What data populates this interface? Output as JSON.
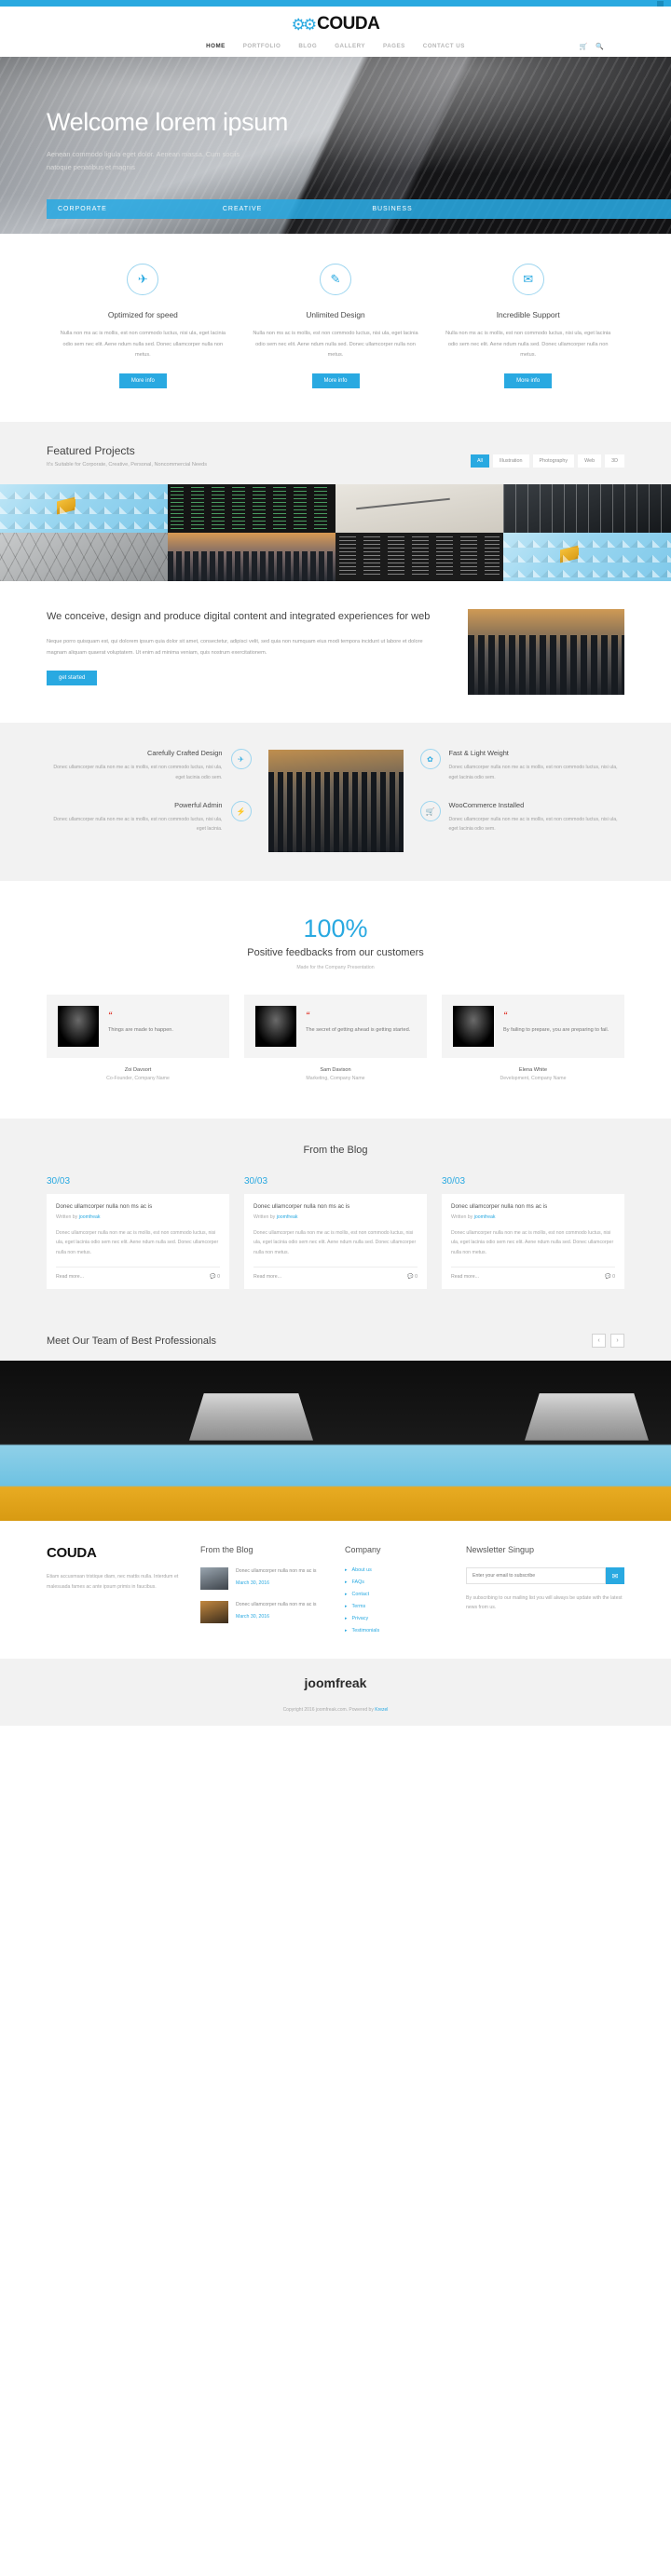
{
  "brand": {
    "name": "COUDA",
    "gears_icon": "gears-icon",
    "accent": "#29a9e1"
  },
  "nav": {
    "items": [
      {
        "label": "HOME",
        "active": true
      },
      {
        "label": "PORTFOLIO",
        "active": false
      },
      {
        "label": "BLOG",
        "active": false
      },
      {
        "label": "GALLERY",
        "active": false
      },
      {
        "label": "PAGES",
        "active": false
      },
      {
        "label": "CONTACT US",
        "active": false
      }
    ],
    "cart_icon": "cart-icon",
    "search_icon": "search-icon"
  },
  "hero": {
    "title": "Welcome lorem ipsum",
    "subtitle": "Aenean commodo ligula eget dolor. Aenean massa. Cum sociis natoque penatibus et magnis",
    "strip": [
      "CORPORATE",
      "CREATIVE",
      "BUSINESS"
    ]
  },
  "services": {
    "items": [
      {
        "icon": "rocket-icon",
        "title": "Optimized for speed",
        "text": "Nulla non ms ac is mollis, est non commodo luctus, nisi ula, eget lacinia odio sem nec elit. Aene ndum nulla sed. Donec ullamcorper nulla non metus.",
        "button": "More info"
      },
      {
        "icon": "pencil-icon",
        "title": "Unlimited Design",
        "text": "Nulla non ms ac is mollis, est non commodo luctus, nisi ula, eget lacinia odio sem nec elit. Aene ndum nulla sed. Donec ullamcorper nulla non metus.",
        "button": "More info"
      },
      {
        "icon": "chat-icon",
        "title": "Incredible Support",
        "text": "Nulla non ms ac is mollis, est non commodo luctus, nisi ula, eget lacinia odio sem nec elit. Aene ndum nulla sed. Donec ullamcorper nulla non metus.",
        "button": "More info"
      }
    ]
  },
  "featured": {
    "title": "Featured Projects",
    "subtitle": "It's Suitable for Corporate, Creative, Personal, Noncommercial Needs",
    "filters": [
      {
        "label": "All",
        "active": true
      },
      {
        "label": "Illustration",
        "active": false
      },
      {
        "label": "Photography",
        "active": false
      },
      {
        "label": "Web",
        "active": false
      },
      {
        "label": "3D",
        "active": false
      }
    ]
  },
  "conceive": {
    "title": "We conceive, design and produce digital content and integrated experiences for web",
    "text": "Neque porro quisquam est, qui dolorem ipsum quia dolor sit amet, consectetur, adipisci velit, sed quia non numquam eius modi tempora incidunt ut labore et dolore magnam aliquam quaerat voluptatem. Ut enim ad minima veniam, quis nostrum exercitationem.",
    "button": "get started"
  },
  "crafted": {
    "left": [
      {
        "icon": "rocket-icon",
        "title": "Carefully Crafted Design",
        "text": "Donec ullamcorper nulla non me ac is mollis, est non commodo luctus, nisi ula, eget lacinia odio sem."
      },
      {
        "icon": "bolt-icon",
        "title": "Powerful Admin",
        "text": "Donec ullamcorper nulla non me ac is mollis, est non commodo luctus, nisi ula, eget lacinia."
      }
    ],
    "right": [
      {
        "icon": "leaf-icon",
        "title": "Fast & Light Weight",
        "text": "Donec ullamcorper nulla non me ac is mollis, est non commodo luctus, nisi ula, eget lacinia odio sem."
      },
      {
        "icon": "cart-icon",
        "title": "WooCommerce Installed",
        "text": "Donec ullamcorper nulla non me ac is mollis, est non commodo luctus, nisi ula, eget lacinia odio sem."
      }
    ]
  },
  "testimonials": {
    "percent": "100%",
    "headline": "Positive feedbacks from our customers",
    "made": "Made for the Company Presentation",
    "cards": [
      {
        "quote": "Things are made to happen.",
        "name": "Zoi Davsort",
        "role": "Co-Founder, Company Name"
      },
      {
        "quote": "The secret of getting ahead is getting started.",
        "name": "Sam Davison",
        "role": "Marketing, Company Name"
      },
      {
        "quote": "By failing to prepare, you are preparing to fail.",
        "name": "Elena White",
        "role": "Development, Company Name"
      }
    ]
  },
  "blog": {
    "title": "From the Blog",
    "posts": [
      {
        "date": "30/03",
        "title": "Donec ullamcorper nulla non ms ac is",
        "written_by": "Written by",
        "author": "joomfreak",
        "excerpt": "Donec ullamcorper nulla non me ac is mollis, est non commodo luctus, nisi ula, eget lacinia odio sem nec elit. Aene ndum nulla sed. Donec ullamcorper nulla non metus.",
        "read_more": "Read more...",
        "comments": "0"
      },
      {
        "date": "30/03",
        "title": "Donec ullamcorper nulla non ms ac is",
        "written_by": "Written by",
        "author": "joomfreak",
        "excerpt": "Donec ullamcorper nulla non me ac is mollis, est non commodo luctus, nisi ula, eget lacinia odio sem nec elit. Aene ndum nulla sed. Donec ullamcorper nulla non metus.",
        "read_more": "Read more...",
        "comments": "0"
      },
      {
        "date": "30/03",
        "title": "Donec ullamcorper nulla non ms ac is",
        "written_by": "Written by",
        "author": "joomfreak",
        "excerpt": "Donec ullamcorper nulla non me ac is mollis, est non commodo luctus, nisi ula, eget lacinia odio sem nec elit. Aene ndum nulla sed. Donec ullamcorper nulla non metus.",
        "read_more": "Read more...",
        "comments": "0"
      }
    ]
  },
  "team": {
    "title": "Meet Our Team of Best Professionals",
    "prev_icon": "chevron-left-icon",
    "next_icon": "chevron-right-icon"
  },
  "footer": {
    "brand": "COUDA",
    "description": "Etiam accusmsan tristique diam, nec mattis nulla. Interdum et malesuada fames ac ante ipsum primis in faucibus.",
    "blog": {
      "heading": "From the Blog",
      "posts": [
        {
          "title": "Donec ullamcorper nulla non ms ac is",
          "date": "March 30, 2016"
        },
        {
          "title": "Donec ullamcorper nulla non ms ac is",
          "date": "March 30, 2016"
        }
      ]
    },
    "company": {
      "heading": "Company",
      "links": [
        "About us",
        "FAQs",
        "Contact",
        "Terms",
        "Privacy",
        "Testimonials"
      ]
    },
    "newsletter": {
      "heading": "Newsletter Singup",
      "placeholder": "Enter your email to subscribe",
      "button_icon": "send-icon",
      "text": "By subscribing to our mailing list you will always be update with the latest news from us."
    }
  },
  "bottom": {
    "brand": "joomfreak",
    "copyright": "Copyright 2016 joomfreak.com. Powered by",
    "powered_by": "Krezel"
  }
}
